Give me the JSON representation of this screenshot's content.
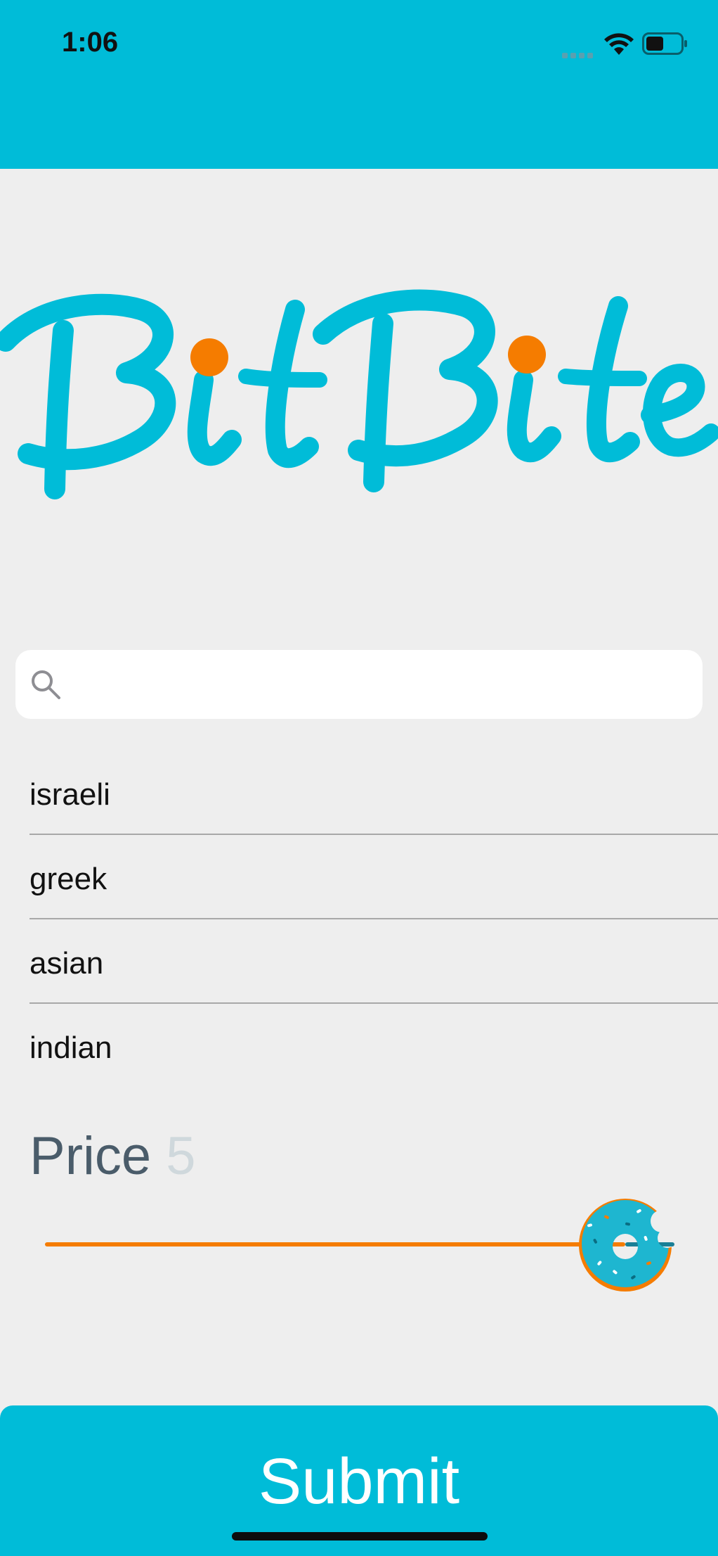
{
  "status_bar": {
    "time": "1:06",
    "icons": [
      "cellular-signal-icon",
      "wifi-icon",
      "battery-icon"
    ]
  },
  "logo": {
    "text": "BitBite",
    "colors": {
      "primary": "#00bcd8",
      "dots": "#f57c00"
    }
  },
  "search": {
    "placeholder": "",
    "value": "",
    "icon": "search-icon"
  },
  "cuisines": [
    {
      "label": "israeli"
    },
    {
      "label": "greek"
    },
    {
      "label": "asian"
    },
    {
      "label": "indian"
    }
  ],
  "price": {
    "label": "Price",
    "value": "5",
    "slider": {
      "min": 0,
      "max": 5,
      "current": 5,
      "thumb_icon": "donut-icon"
    }
  },
  "submit": {
    "label": "Submit"
  },
  "colors": {
    "accent": "#00bcd8",
    "background": "#eeeeee",
    "slider_fill": "#f57c00",
    "slider_rest": "#1a7f96",
    "price_label": "#4a5c6a",
    "price_value": "#cfd8dc"
  }
}
